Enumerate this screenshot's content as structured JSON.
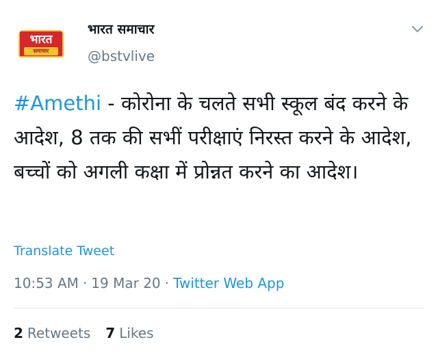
{
  "account": {
    "display_name": "भारत समाचार",
    "handle": "@bstvlive",
    "logo_main": "भारत",
    "logo_sub": "समाचार"
  },
  "tweet": {
    "hashtag": "#Amethi",
    "text": " - कोरोना के चलते सभी स्कूल बंद करने के आदेश, 8 तक की सभीं परीक्षाएं निरस्त करने के आदेश, बच्चों को अगली कक्षा में प्रोन्नत करने का आदेश।",
    "translate_label": "Translate Tweet"
  },
  "meta": {
    "time": "10:53 AM",
    "separator": "·",
    "date": "19 Mar 20",
    "source": "Twitter Web App"
  },
  "stats": {
    "retweets_count": "2",
    "retweets_label": "Retweets",
    "likes_count": "7",
    "likes_label": "Likes"
  },
  "colors": {
    "link": "#1b95e0",
    "secondary_text": "#657786",
    "primary_text": "#14171a",
    "logo_red": "#d7262c",
    "logo_yellow": "#f2c230"
  },
  "icons": {
    "menu": "chevron-down-icon"
  }
}
